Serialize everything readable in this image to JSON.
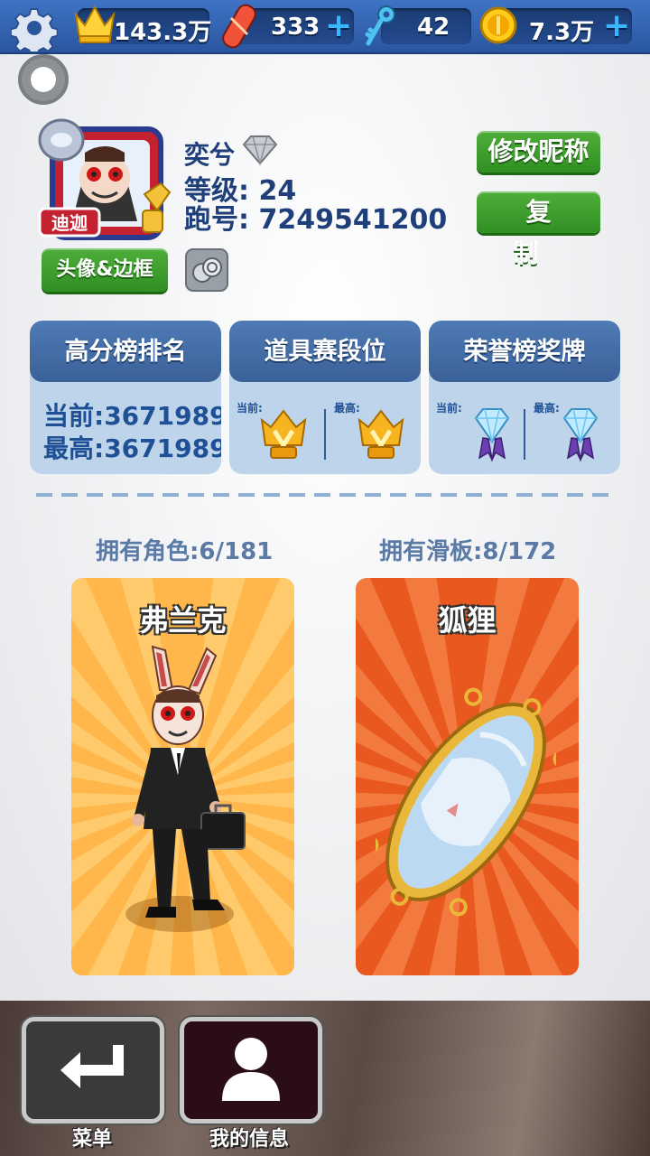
{
  "currency": {
    "crowns": "143.3万",
    "boards": "333",
    "keys": "42",
    "coins": "7.3万",
    "plus": "+"
  },
  "profile": {
    "name": "奕兮",
    "level_label": "等级:",
    "level": "24",
    "runid_label": "跑号:",
    "runid": "7249541200",
    "avatar_badge": "迪迦",
    "rename_button": "修改昵称",
    "copy_button": "复制",
    "frame_button": "头像&边框"
  },
  "cards": {
    "highscore": {
      "title": "高分榜排名",
      "current": "当前:3671989",
      "best": "最高:3671989"
    },
    "item_tier": {
      "title": "道具赛段位",
      "current_label": "当前:",
      "best_label": "最高:"
    },
    "honor": {
      "title": "荣誉榜奖牌",
      "current_label": "当前:",
      "best_label": "最高:"
    }
  },
  "collection": {
    "chars_owned": "拥有角色:6/181",
    "boards_owned": "拥有滑板:8/172",
    "char_name": "弗兰克",
    "board_name": "狐狸"
  },
  "nav": {
    "menu_label": "菜单",
    "info_label": "我的信息"
  },
  "colors": {
    "topbar": "#2f5fae",
    "button_green": "#3d9f2c",
    "card_header": "#4a73ad",
    "text_blue": "#1f3f7a"
  }
}
